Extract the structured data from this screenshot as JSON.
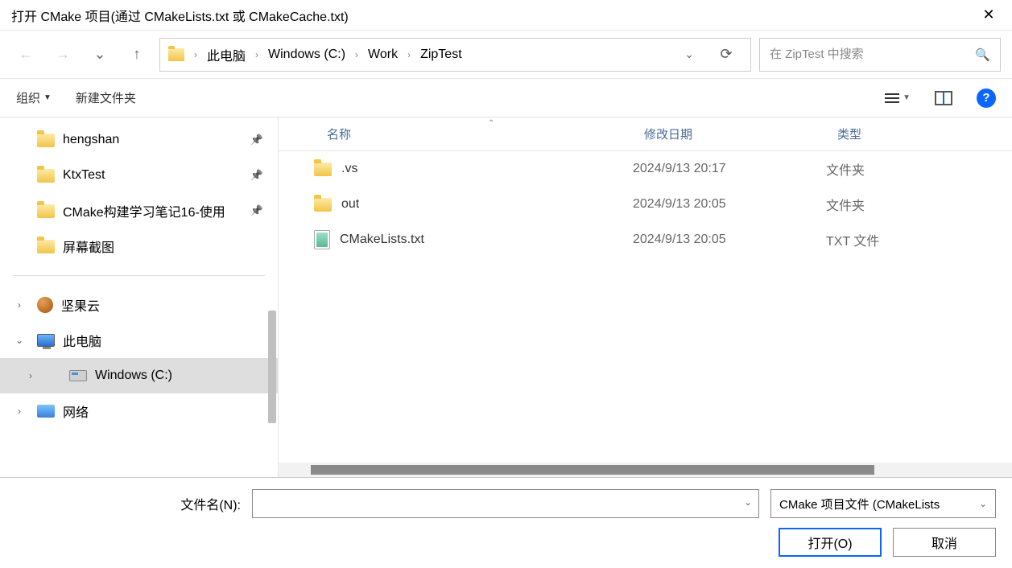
{
  "title": "打开 CMake 项目(通过 CMakeLists.txt 或 CMakeCache.txt)",
  "breadcrumb": [
    "此电脑",
    "Windows (C:)",
    "Work",
    "ZipTest"
  ],
  "search_placeholder": "在 ZipTest 中搜索",
  "toolbar": {
    "organize": "组织",
    "newfolder": "新建文件夹"
  },
  "sidebar": {
    "pinned": [
      {
        "label": "hengshan"
      },
      {
        "label": "KtxTest"
      },
      {
        "label": "CMake构建学习笔记16-使用"
      },
      {
        "label": "屏幕截图"
      }
    ],
    "tree": [
      {
        "label": "坚果云",
        "icon": "nut",
        "expand": "right"
      },
      {
        "label": "此电脑",
        "icon": "pc",
        "expand": "down"
      },
      {
        "label": "Windows (C:)",
        "icon": "drive",
        "expand": "right",
        "indent": 2,
        "selected": true
      },
      {
        "label": "网络",
        "icon": "net",
        "expand": "right"
      }
    ]
  },
  "columns": {
    "name": "名称",
    "date": "修改日期",
    "type": "类型"
  },
  "files": [
    {
      "name": ".vs",
      "date": "2024/9/13 20:17",
      "type": "文件夹",
      "icon": "folder"
    },
    {
      "name": "out",
      "date": "2024/9/13 20:05",
      "type": "文件夹",
      "icon": "folder"
    },
    {
      "name": "CMakeLists.txt",
      "date": "2024/9/13 20:05",
      "type": "TXT 文件",
      "icon": "txt"
    }
  ],
  "footer": {
    "filename_label": "文件名(N):",
    "filename_value": "",
    "filter": "CMake 项目文件  (CMakeLists",
    "open": "打开(O)",
    "cancel": "取消"
  }
}
